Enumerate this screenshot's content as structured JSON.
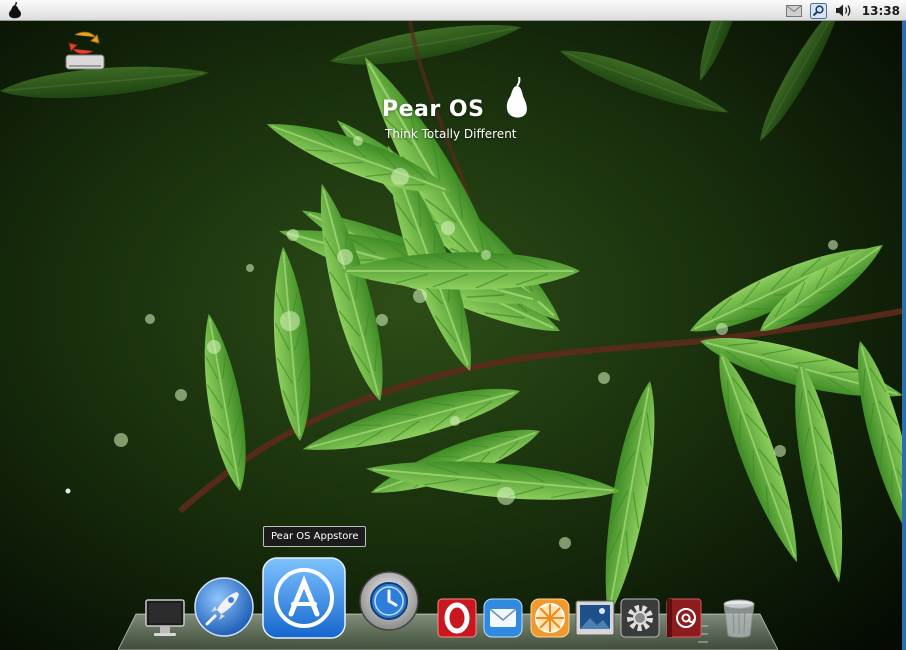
{
  "menubar": {
    "logo_icon": "pear-logo-icon",
    "tray": {
      "icons": [
        "mail-icon",
        "search-icon",
        "volume-icon"
      ],
      "clock": "13:38"
    }
  },
  "desktop": {
    "wallpaper": "green-fern-leaves-with-water-drops",
    "icon": {
      "icon": "drive-icon"
    },
    "brand": {
      "name": "Pear OS",
      "tagline": "Think Totally Different",
      "icon": "pear-fruit-icon"
    }
  },
  "tooltip": {
    "text": "Pear OS Appstore"
  },
  "dock": {
    "items": [
      {
        "icon": "computer-icon"
      },
      {
        "icon": "rocket-launcher-icon"
      },
      {
        "icon": "appstore-icon",
        "active": true
      },
      {
        "icon": "time-machine-icon"
      },
      {
        "icon": "opera-icon"
      },
      {
        "icon": "mail-envelope-icon"
      },
      {
        "icon": "citrus-icon"
      },
      {
        "icon": "photo-icon"
      },
      {
        "icon": "settings-icon"
      },
      {
        "icon": "address-book-icon"
      },
      {
        "icon": "trash-icon"
      }
    ]
  },
  "colors": {
    "menubar": "#e9e9e9",
    "accent": "#2a6fb0",
    "leaf": "#5aa83a"
  }
}
